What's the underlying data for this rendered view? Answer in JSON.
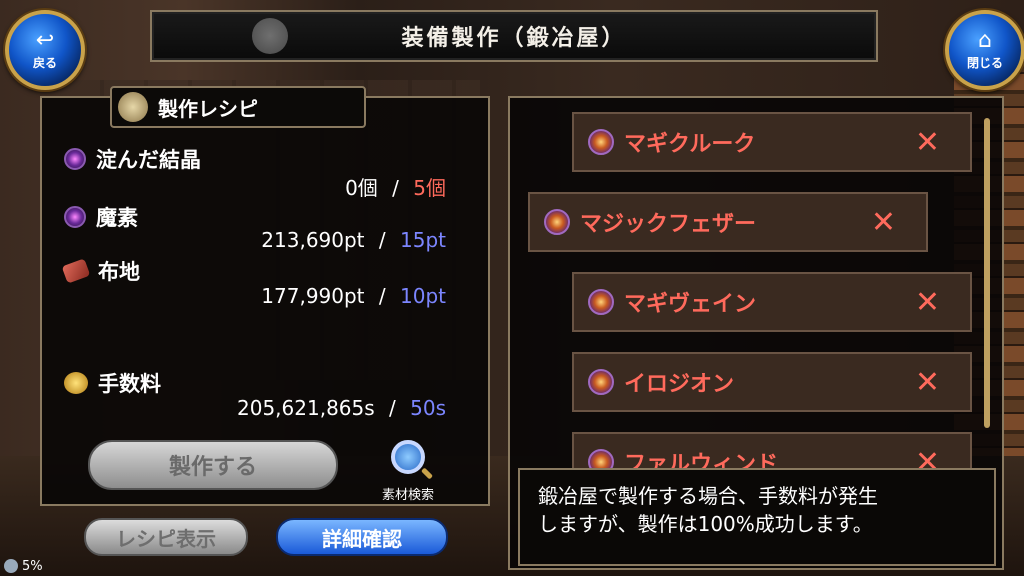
{
  "title": "装備製作（鍛冶屋）",
  "nav": {
    "back_label": "戻る",
    "back_icon": "return-arrow-icon",
    "close_label": "閉じる",
    "close_icon": "home-icon"
  },
  "recipe": {
    "heading": "製作レシピ",
    "materials": [
      {
        "name": "淀んだ結晶",
        "have": "0個",
        "need": "5個"
      },
      {
        "name": "魔素",
        "have": "213,690pt",
        "need": "15pt"
      },
      {
        "name": "布地",
        "have": "177,990pt",
        "need": "10pt"
      },
      {
        "name": "手数料",
        "have": "205,621,865s",
        "need": "50s"
      }
    ],
    "separator": "/",
    "craft_button": "製作する",
    "search_label": "素材検索"
  },
  "bottom_buttons": {
    "recipe_display": "レシピ表示",
    "detail_confirm": "詳細確認"
  },
  "list": [
    {
      "name": "マギクルーク",
      "mark": "✕"
    },
    {
      "name": "マジックフェザー",
      "mark": "✕"
    },
    {
      "name": "マギヴェイン",
      "mark": "✕"
    },
    {
      "name": "イロジオン",
      "mark": "✕"
    },
    {
      "name": "ファルウィンド",
      "mark": "✕"
    }
  ],
  "message": "鍛冶屋で製作する場合、手数料が発生\nしますが、製作は100%成功します。",
  "status": {
    "percent": "5%"
  },
  "colors": {
    "insufficient": "#ff6a5c",
    "sufficient": "#7c86ff",
    "accent_blue": "#1a5ad8"
  }
}
